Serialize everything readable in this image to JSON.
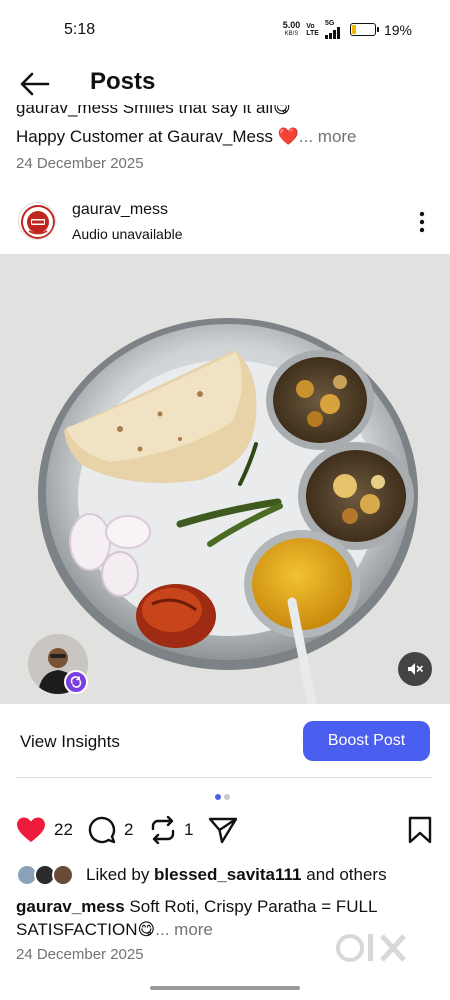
{
  "status_bar": {
    "time": "5:18",
    "net_speed_value": "5.00",
    "net_speed_unit": "KB/S",
    "volte_top": "Vo",
    "volte_bottom": "LTE",
    "network": "5G",
    "battery_percent": "19%",
    "battery_level": 0.19
  },
  "header": {
    "title": "Posts",
    "back_icon": "arrow-left-icon"
  },
  "previous_post": {
    "caption_cut": "gaurav_mess Smiles that say it all😋",
    "caption": "Happy Customer at Gaurav_Mess ❤️",
    "more": "... more",
    "date": "24 December 2025"
  },
  "post": {
    "username": "gaurav_mess",
    "audio": "Audio unavailable",
    "more_icon": "kebab-menu-icon",
    "insights_label": "View Insights",
    "boost_label": "Boost Post",
    "likes_count": "22",
    "comments_count": "2",
    "reposts_count": "1",
    "liked_by_prefix": "Liked by ",
    "liked_by_user": "blessed_savita111",
    "liked_by_suffix": " and others",
    "caption_user": "gaurav_mess",
    "caption_text": " Soft Roti, Crispy Paratha = FULL SATISFACTION😋",
    "caption_more": "... more",
    "date": "24 December 2025",
    "carousel_total": 2,
    "carousel_active": 1
  },
  "colors": {
    "like": "#ed1c3a",
    "boost": "#4a5ef0",
    "muted_text": "#737373",
    "dot_active": "#4a5ef0",
    "dot_inactive": "#c8c8c8"
  },
  "watermark": "OLX"
}
